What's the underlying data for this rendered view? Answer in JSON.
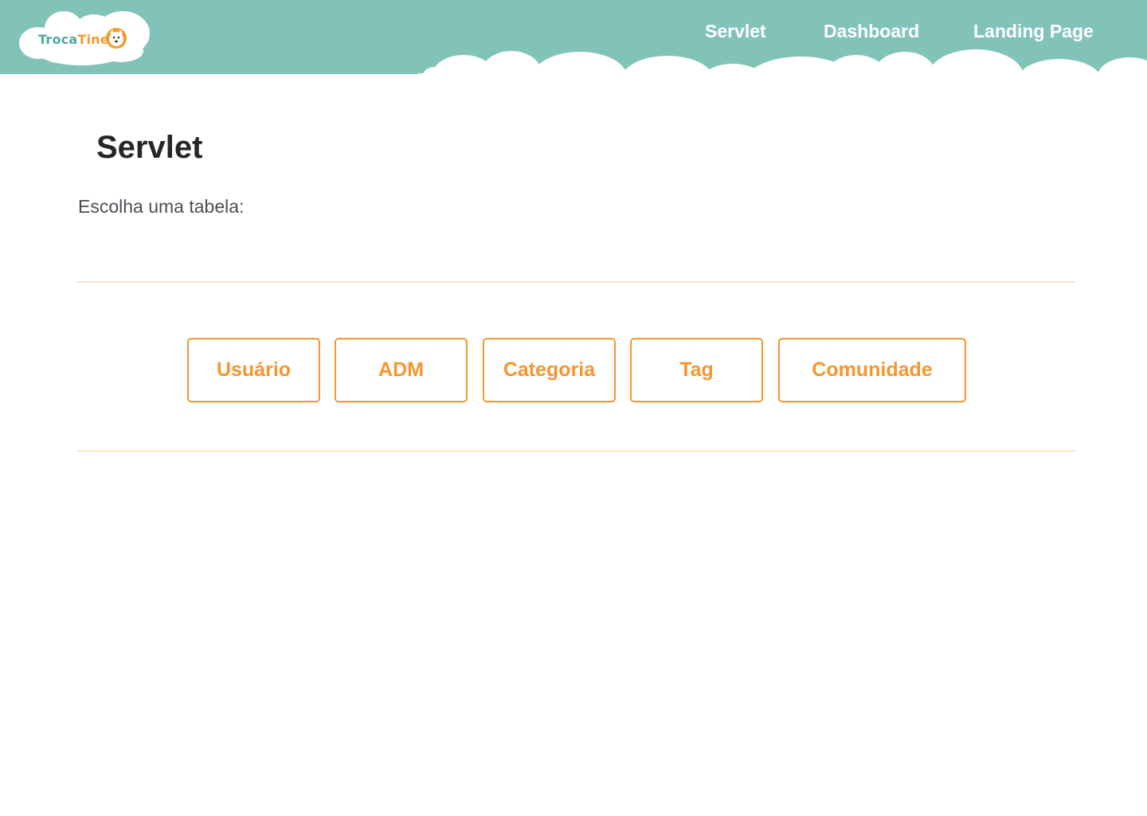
{
  "brand": {
    "name_part1": "Troca",
    "name_part2": "Tine",
    "logo_icon": "dog-face-icon"
  },
  "nav": {
    "items": [
      {
        "label": "Servlet"
      },
      {
        "label": "Dashboard"
      },
      {
        "label": "Landing Page"
      }
    ]
  },
  "main": {
    "title": "Servlet",
    "subtitle": "Escolha uma tabela:",
    "buttons": [
      {
        "label": "Usuário"
      },
      {
        "label": "ADM"
      },
      {
        "label": "Categoria"
      },
      {
        "label": "Tag"
      },
      {
        "label": "Comunidade"
      }
    ]
  },
  "colors": {
    "header_bg": "#82c3b9",
    "accent_orange": "#f5962e",
    "divider": "#fde3c3",
    "brand_teal": "#4fa79b"
  }
}
